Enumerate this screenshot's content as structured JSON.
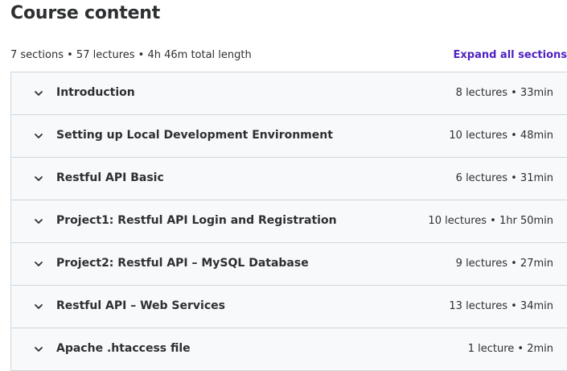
{
  "header": {
    "title": "Course content",
    "summary": "7 sections • 57 lectures • 4h 46m total length",
    "expand_label": "Expand all sections"
  },
  "sections": [
    {
      "title": "Introduction",
      "meta": "8 lectures • 33min"
    },
    {
      "title": "Setting up Local Development Environment",
      "meta": "10 lectures • 48min"
    },
    {
      "title": "Restful API Basic",
      "meta": "6 lectures • 31min"
    },
    {
      "title": "Project1: Restful API Login and Registration",
      "meta": "10 lectures • 1hr 50min"
    },
    {
      "title": "Project2: Restful API – MySQL Database",
      "meta": "9 lectures • 27min"
    },
    {
      "title": "Restful API – Web Services",
      "meta": "13 lectures • 34min"
    },
    {
      "title": "Apache .htaccess file",
      "meta": "1 lecture • 2min"
    }
  ],
  "icons": {
    "section_toggle": "chevron-down-icon"
  },
  "colors": {
    "accent": "#5022c3",
    "text": "#2d2f31",
    "section_bg": "#f7f9fa",
    "border": "#d1d7dc"
  }
}
